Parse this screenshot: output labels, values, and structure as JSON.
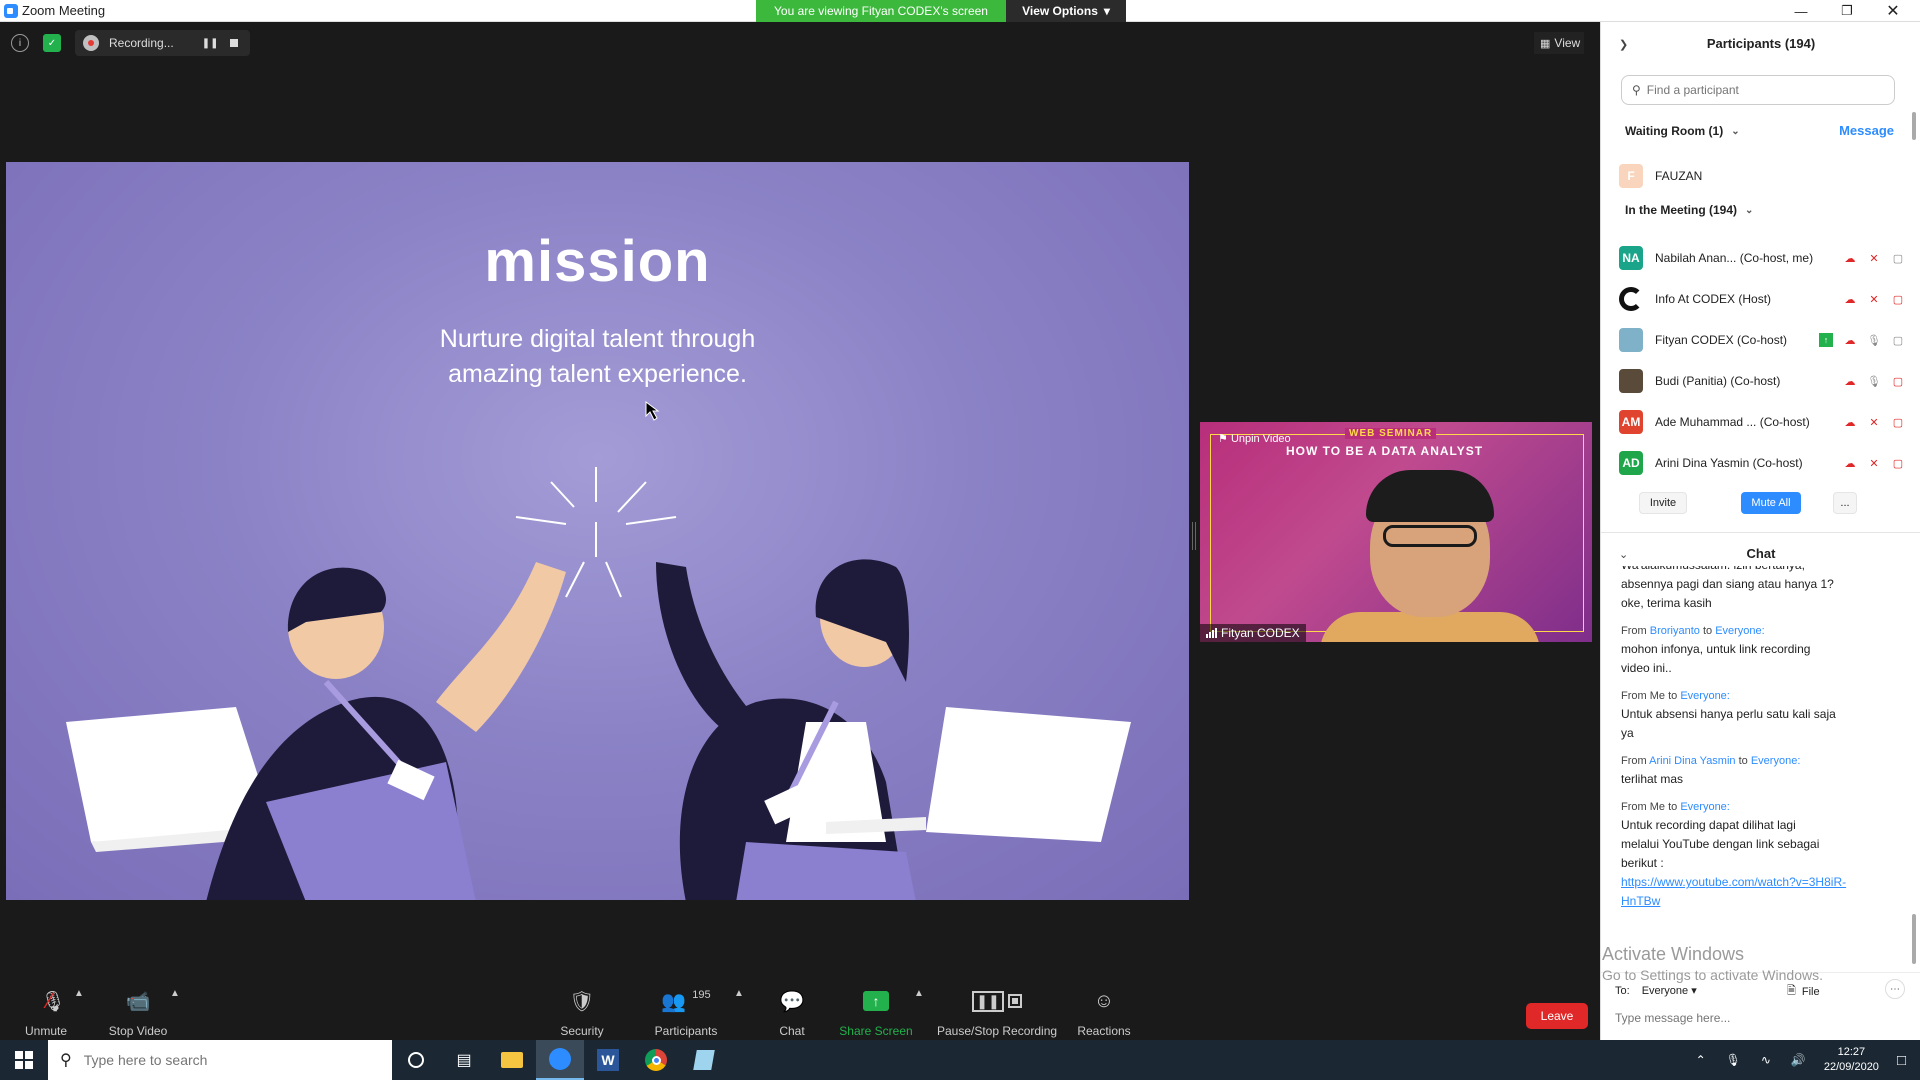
{
  "window": {
    "title": "Zoom Meeting",
    "viewing_banner": "You are viewing Fityan CODEX's screen",
    "view_options": "View Options",
    "colors": {
      "banner": "#3cb93c",
      "accent": "#2d8cff",
      "leave": "#e02828"
    }
  },
  "top_bar": {
    "recording_label": "Recording...",
    "view_label": "View"
  },
  "slide": {
    "title": "mission",
    "subtitle_line1": "Nurture digital talent through",
    "subtitle_line2": "amazing talent experience."
  },
  "video": {
    "unpin_label": "Unpin Video",
    "seminar_tag": "WEB SEMINAR",
    "seminar_title": "HOW TO BE A DATA ANALYST",
    "participant_name": "Fityan CODEX"
  },
  "toolbar": {
    "unmute": "Unmute",
    "stop_video": "Stop Video",
    "security": "Security",
    "participants": "Participants",
    "participants_count": "195",
    "chat": "Chat",
    "share_screen": "Share Screen",
    "pause_stop_recording": "Pause/Stop Recording",
    "reactions": "Reactions",
    "leave": "Leave"
  },
  "participants_panel": {
    "title": "Participants (194)",
    "search_placeholder": "Find a participant",
    "waiting_room": "Waiting Room (1)",
    "message_link": "Message",
    "waiting": [
      {
        "initial": "F",
        "name": "FAUZAN",
        "color": "#f8d5bc"
      }
    ],
    "in_meeting": "In the Meeting (194)",
    "members": [
      {
        "initials": "NA",
        "name": "Nabilah Anan... (Co-host, me)",
        "color": "#1aa58a"
      },
      {
        "initials": "",
        "name": "Info At CODEX (Host)",
        "color": "#ffffff"
      },
      {
        "initials": "",
        "name": "Fityan CODEX (Co-host)",
        "color": "#7fb2c8"
      },
      {
        "initials": "",
        "name": "Budi (Panitia) (Co-host)",
        "color": "#5a4a3a"
      },
      {
        "initials": "AM",
        "name": "Ade Muhammad ... (Co-host)",
        "color": "#e0442e"
      },
      {
        "initials": "AD",
        "name": "Arini Dina Yasmin (Co-host)",
        "color": "#1fa64a"
      }
    ],
    "invite": "Invite",
    "mute_all": "Mute All",
    "more": "..."
  },
  "chat": {
    "title": "Chat",
    "messages": [
      {
        "from": "",
        "to": "",
        "lines": [
          "Wa'alaikumussalam. izin bertanya,",
          "absennya pagi dan siang atau hanya 1?",
          "oke, terima kasih"
        ]
      },
      {
        "from": "Broriyanto",
        "to": "Everyone:",
        "lines": [
          "mohon infonya, untuk link recording",
          "video ini.."
        ]
      },
      {
        "from": "Me",
        "to": "Everyone:",
        "lines": [
          "Untuk absensi hanya perlu satu kali saja",
          "ya"
        ]
      },
      {
        "from": "Arini Dina Yasmin",
        "to": "Everyone:",
        "lines": [
          "terlihat mas"
        ]
      },
      {
        "from": "Me",
        "to": "Everyone:",
        "lines": [
          "Untuk recording dapat dilihat lagi",
          "melalui YouTube dengan link sebagai",
          "berikut :"
        ],
        "link": "https://www.youtube.com/watch?v=3H8iR-HnTBw"
      }
    ],
    "from_word": "From",
    "to_word": "to",
    "to_label": "To:",
    "to_value": "Everyone",
    "file_label": "File",
    "input_placeholder": "Type message here...",
    "activate_windows_1": "Activate Windows",
    "activate_windows_2": "Go to Settings to activate Windows."
  },
  "taskbar": {
    "search_placeholder": "Type here to search",
    "time": "12:27",
    "date": "22/09/2020"
  }
}
